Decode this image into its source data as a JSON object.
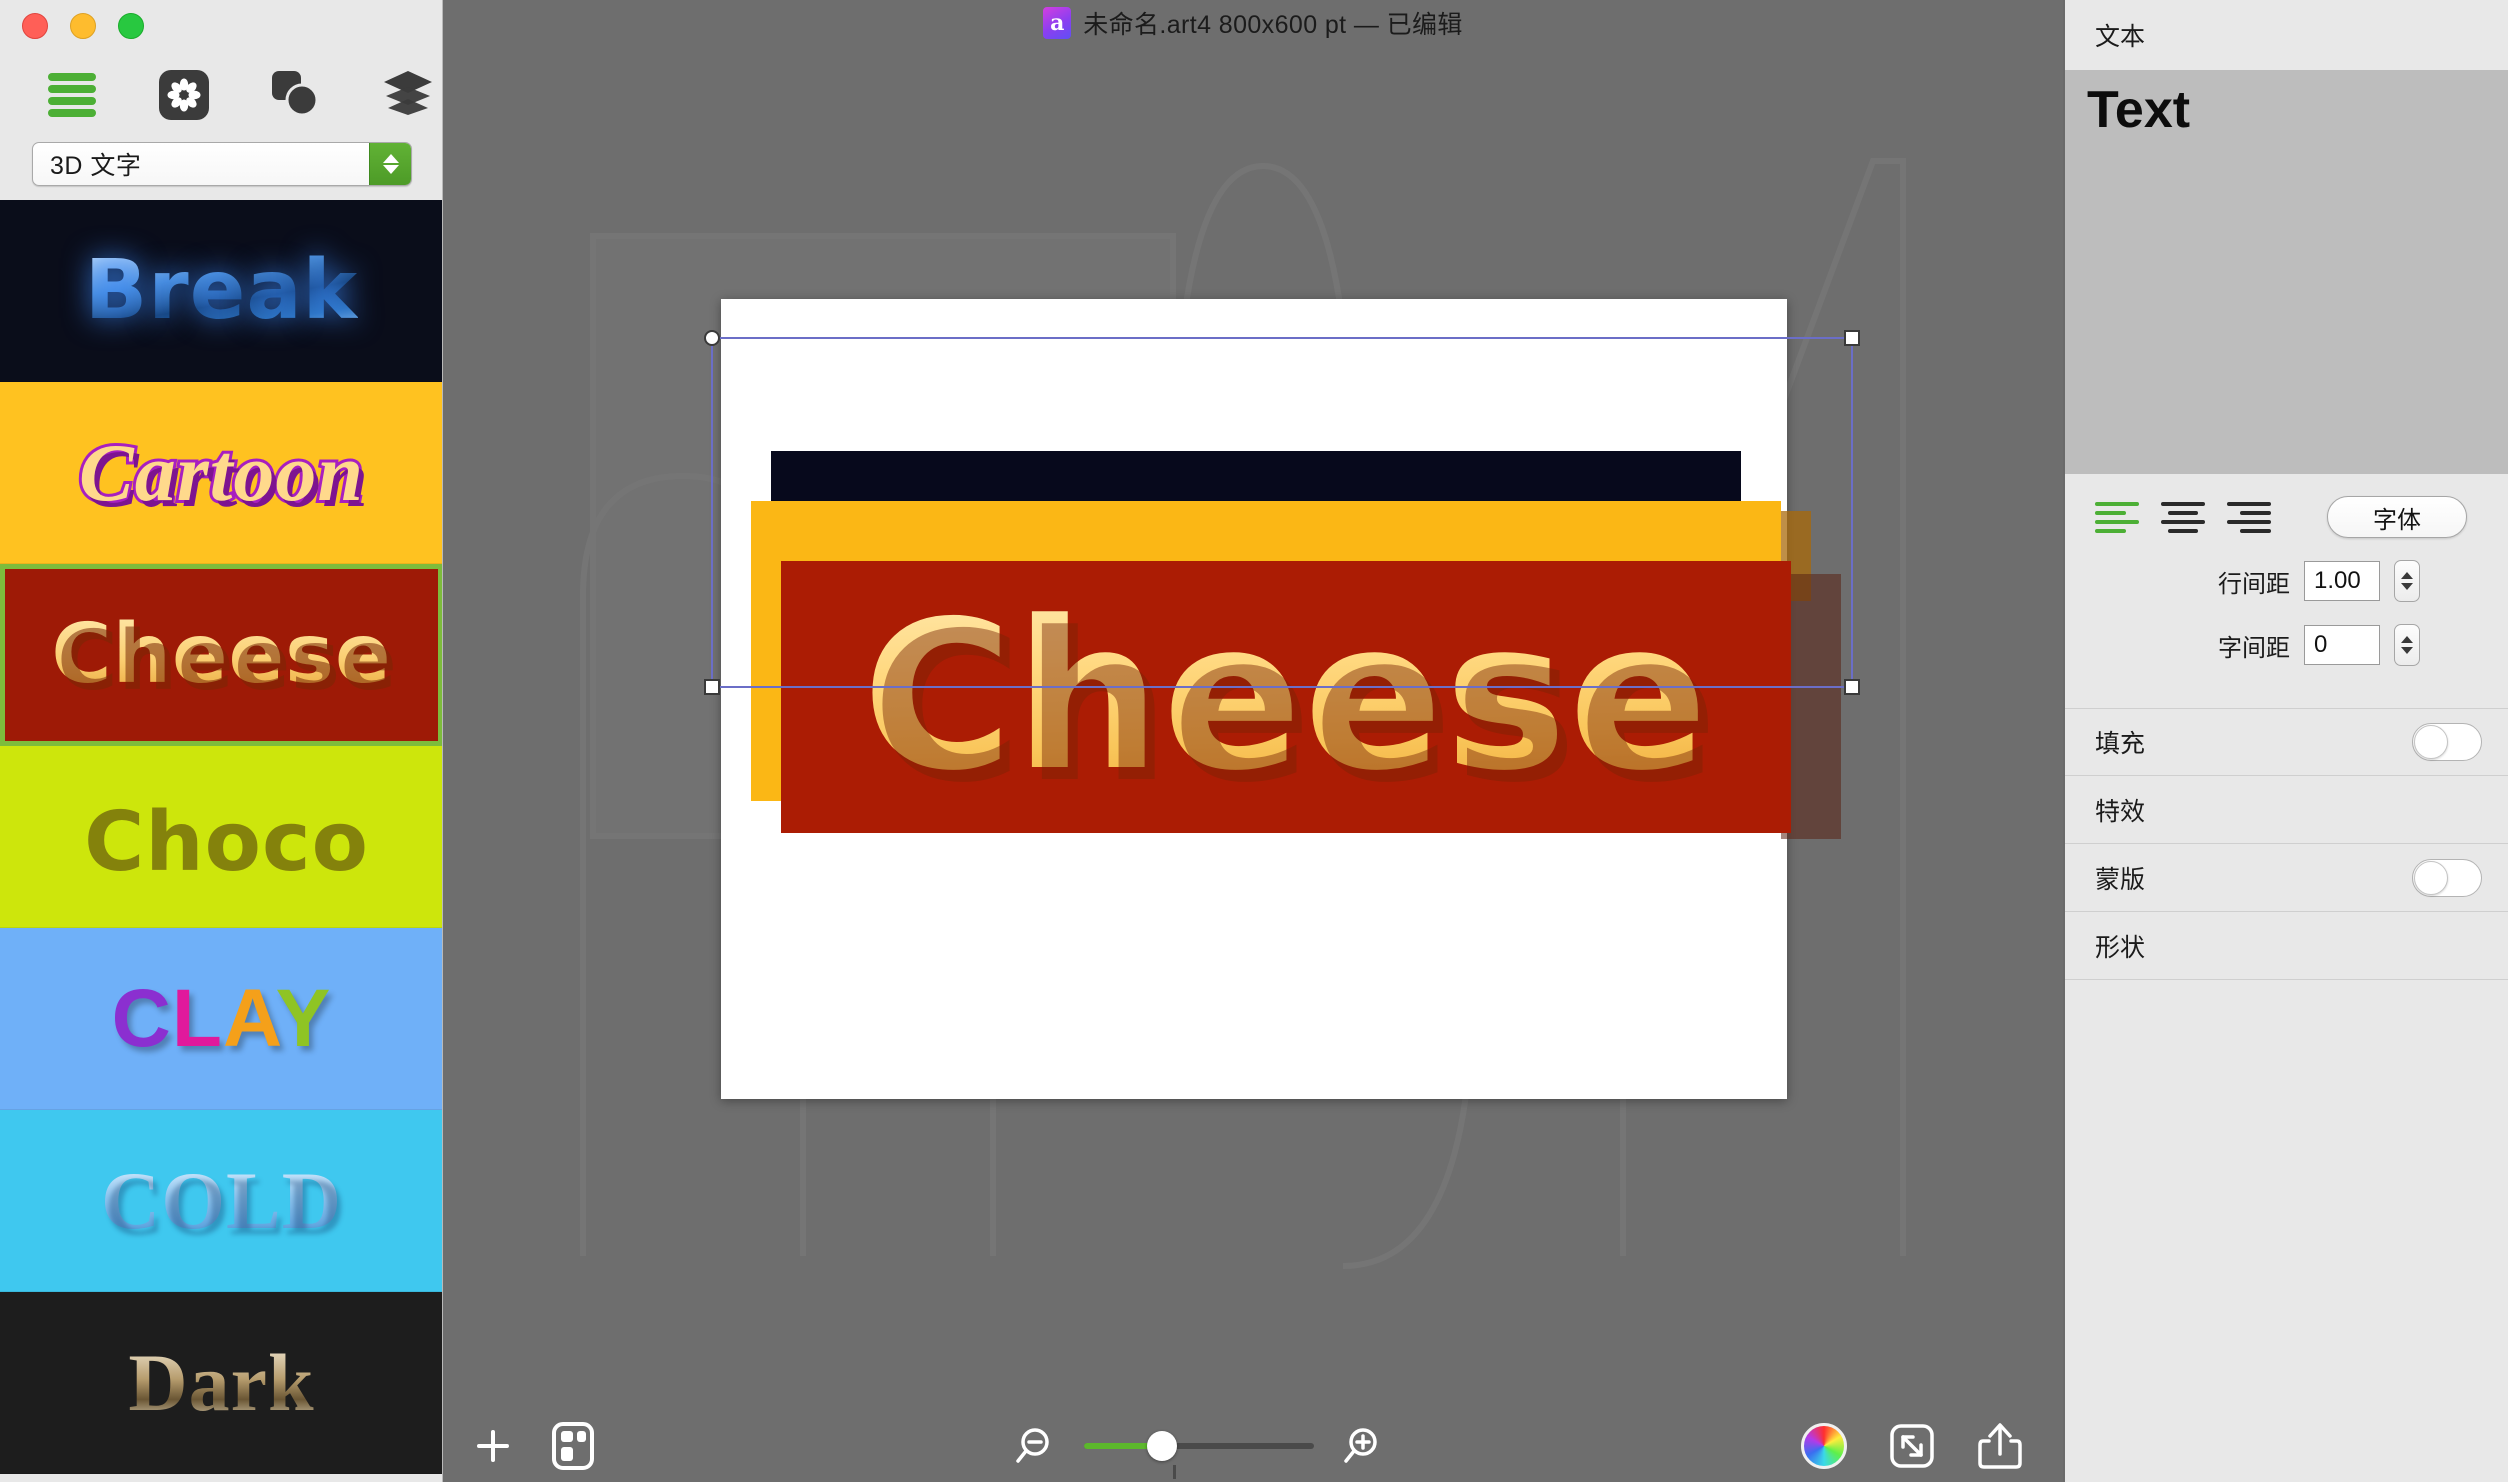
{
  "window": {
    "title": "未命名.art4 800x600 pt — 已编辑",
    "doc_icon_letter": "a",
    "traffic_lights": [
      "close-red",
      "minimize-yellow",
      "zoom-green"
    ]
  },
  "sidebar": {
    "toolbar_icons": [
      {
        "name": "list-icon",
        "label": "样式列表",
        "active": true
      },
      {
        "name": "flower-gear-icon",
        "label": "照片",
        "active": false
      },
      {
        "name": "shapes-icon",
        "label": "形状",
        "active": false
      },
      {
        "name": "layers-icon",
        "label": "图层",
        "active": false
      }
    ],
    "category_select": {
      "value": "3D 文字",
      "options": [
        "3D 文字"
      ]
    },
    "presets": [
      {
        "name": "break",
        "label": "Break",
        "selected": false,
        "bg": "#0a0d1a"
      },
      {
        "name": "cartoon",
        "label": "Cartoon",
        "selected": false,
        "bg": "#ffc220"
      },
      {
        "name": "cheese",
        "label": "Cheese",
        "selected": true,
        "bg": "#9e1a06"
      },
      {
        "name": "choco",
        "label": "Choco",
        "selected": false,
        "bg": "#cde60c"
      },
      {
        "name": "clay",
        "label": "CLAY",
        "selected": false,
        "bg": "#6fb0f8"
      },
      {
        "name": "cold",
        "label": "COLD",
        "selected": false,
        "bg": "#3fc8ef"
      },
      {
        "name": "dark",
        "label": "Dark",
        "selected": false,
        "bg": "#1d1d1d"
      }
    ],
    "clay_letters": [
      "C",
      "L",
      "A",
      "Y"
    ]
  },
  "canvas": {
    "artwork_text": "Cheese",
    "layers": [
      {
        "name": "black-bar",
        "color": "#07091c"
      },
      {
        "name": "orange-panel",
        "color": "#fbb715"
      },
      {
        "name": "red-panel",
        "color": "#ab1c04"
      }
    ],
    "selection": {
      "visible": true,
      "handles": 4
    }
  },
  "bottom_bar": {
    "add_label": "add-icon",
    "grid_label": "grid-layout-icon",
    "zoom_out_label": "zoom-out-icon",
    "zoom_in_label": "zoom-in-icon",
    "zoom_value_percent": 34,
    "color_wheel_label": "color-wheel-icon",
    "fit_label": "fit-to-screen-icon",
    "share_label": "share-icon"
  },
  "right_panel": {
    "header": "文本",
    "preview_text": "Text",
    "alignment": {
      "options": [
        "left",
        "center",
        "right"
      ],
      "selected": "left"
    },
    "font_button": "字体",
    "fields": [
      {
        "name": "line-spacing",
        "label": "行间距",
        "value": "1.00"
      },
      {
        "name": "letter-spacing",
        "label": "字间距",
        "value": "0"
      }
    ],
    "sections": [
      {
        "name": "fill",
        "label": "填充",
        "has_toggle": true,
        "enabled": false
      },
      {
        "name": "effects",
        "label": "特效",
        "has_toggle": false,
        "enabled": false
      },
      {
        "name": "mask",
        "label": "蒙版",
        "has_toggle": true,
        "enabled": false
      },
      {
        "name": "shape",
        "label": "形状",
        "has_toggle": false,
        "enabled": false
      }
    ]
  },
  "colors": {
    "accent_green": "#4caf35",
    "selection_blue": "#6b6ec7",
    "panel_gray": "#e8e8e8",
    "canvas_gray": "#6e6e6e"
  }
}
